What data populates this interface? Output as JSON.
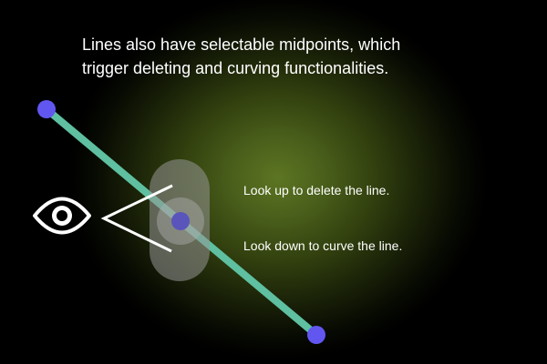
{
  "instruction": {
    "line1": "Lines also have selectable midpoints, which",
    "line2": "trigger deleting and curving functionalities."
  },
  "hints": {
    "up": "Look up to delete the line.",
    "down": "Look down to curve the line."
  },
  "colors": {
    "line": "#5ec0a0",
    "endpoint": "#6157f0",
    "midpoint": "#5a55bb",
    "selector": "#8a8a8a",
    "background_glow": "#5c7522"
  },
  "icons": {
    "gaze": "eye-icon",
    "direction": "chevron-left-icon"
  }
}
